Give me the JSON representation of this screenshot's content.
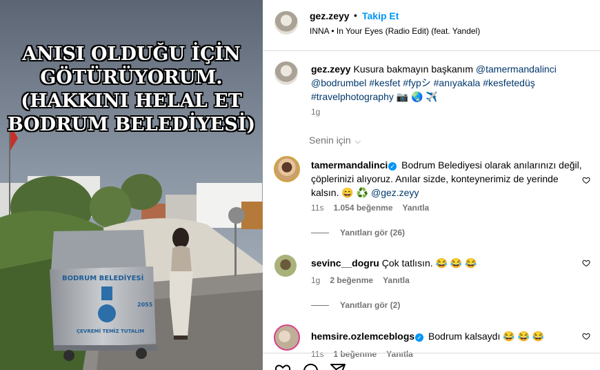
{
  "post": {
    "overlay_caption": [
      "ANISI OLDUĞU İÇİN",
      "GÖTÜRÜYORUM.",
      "(HAKKINI HELAL ET",
      "BODRUM BELEDİYESİ)"
    ],
    "bin_labels": {
      "brand": "BODRUM BELEDİYESİ",
      "number": "2055",
      "slogan": "ÇEVREMİ TEMİZ TUTALIM"
    }
  },
  "header": {
    "username": "gez.zeyy",
    "separator": "•",
    "follow_label": "Takip Et",
    "music": "INNA • In Your Eyes (Radio Edit) (feat. Yandel)"
  },
  "caption": {
    "username": "gez.zeyy",
    "text": " Kusura bakmayın başkanım ",
    "mention": "@tamermandalinci",
    "tags": "@bodrumbel #kesfet #fypシ #anıyakala #kesfetedüş #travelphotography",
    "emoji": "📷 🌏 ✈️",
    "time": "1g"
  },
  "sort": {
    "label": "Senin için",
    "chevron": "⌵"
  },
  "comments": [
    {
      "username": "tamermandalinci",
      "verified": true,
      "text": " Bodrum Belediyesi olarak anılarınızı değil, çöplerinizi alıyoruz. Anılar sizde, konteynerimiz de yerinde kalsın. 😄 ♻️ ",
      "mention": "@gez.zeyy",
      "time": "11s",
      "likes": "1.054 beğenme",
      "reply": "Yanıtla",
      "replies_label": "Yanıtları gör (26)"
    },
    {
      "username": "sevinc__dogru",
      "verified": false,
      "text": " Çok tatlısın. 😂 😂 😂",
      "time": "1g",
      "likes": "2 beğenme",
      "reply": "Yanıtla",
      "replies_label": "Yanıtları gör (2)"
    },
    {
      "username": "hemsire.ozlemceblogs",
      "verified": true,
      "text": " Bodrum kalsaydı 😂 😂 😂",
      "time": "11s",
      "likes": "1 beğenme",
      "reply": "Yanıtla"
    }
  ],
  "colors": {
    "link": "#00376b",
    "follow": "#0095f6",
    "muted": "#737373"
  }
}
